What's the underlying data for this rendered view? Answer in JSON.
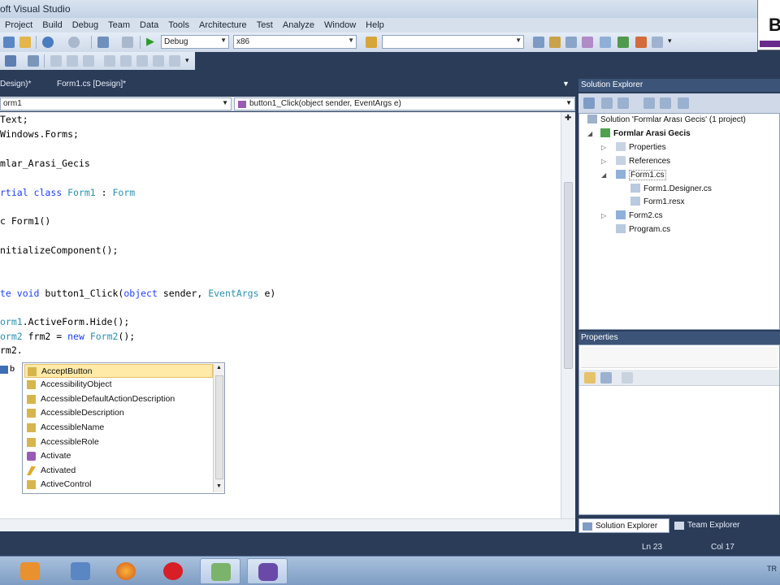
{
  "window": {
    "title": "oft Visual Studio"
  },
  "badge": {
    "letter": "B"
  },
  "menu": [
    "Project",
    "Build",
    "Debug",
    "Team",
    "Data",
    "Tools",
    "Architecture",
    "Test",
    "Analyze",
    "Window",
    "Help"
  ],
  "toolbar": {
    "config": "Debug",
    "platform": "x86",
    "find": ""
  },
  "doc_tabs": [
    {
      "label": "Design)*",
      "active": false
    },
    {
      "label": "Form1.cs [Design]*",
      "active": true
    }
  ],
  "nav": {
    "type": "orm1",
    "member": "button1_Click(object sender, EventArgs e)"
  },
  "code": {
    "l1": "Text;",
    "l2": "Windows.Forms;",
    "l4": "mlar_Arasi_Gecis",
    "l6a": "rtial ",
    "l6b": "class ",
    "l6c": "Form1",
    "l6d": " : ",
    "l6e": "Form",
    "l8a": "c Form1()",
    "l10": "nitializeComponent();",
    "l13a": "te ",
    "l13b": "void",
    "l13c": " button1_Click(",
    "l13d": "object",
    "l13e": " sender, ",
    "l13f": "EventArgs",
    "l13g": " e)",
    "l15a": "orm1",
    "l15b": ".ActiveForm.Hide();",
    "l16a": "orm2",
    "l16b": " frm2 = ",
    "l16c": "new",
    "l16d": " ",
    "l16e": "Form2",
    "l16f": "();",
    "l17": "rm2."
  },
  "intellisense": {
    "gutter_text": "b",
    "items": [
      {
        "label": "AcceptButton",
        "icon": "property-icon",
        "selected": true
      },
      {
        "label": "AccessibilityObject",
        "icon": "property-icon"
      },
      {
        "label": "AccessibleDefaultActionDescription",
        "icon": "property-icon"
      },
      {
        "label": "AccessibleDescription",
        "icon": "property-icon"
      },
      {
        "label": "AccessibleName",
        "icon": "property-icon"
      },
      {
        "label": "AccessibleRole",
        "icon": "property-icon"
      },
      {
        "label": "Activate",
        "icon": "method-icon"
      },
      {
        "label": "Activated",
        "icon": "event-icon"
      },
      {
        "label": "ActiveControl",
        "icon": "property-icon"
      }
    ]
  },
  "solution_explorer": {
    "title": "Solution Explorer",
    "solution": "Solution 'Formlar Arası Gecis' (1 project)",
    "project": "Formlar Arasi Gecis",
    "nodes": [
      "Properties",
      "References",
      "Form1.cs",
      "Form1.Designer.cs",
      "Form1.resx",
      "Form2.cs",
      "Program.cs"
    ]
  },
  "properties": {
    "title": "Properties"
  },
  "bottom_tabs": [
    {
      "label": "Solution Explorer",
      "active": true
    },
    {
      "label": "Team Explorer",
      "active": false
    }
  ],
  "status": {
    "line": "Ln 23",
    "col": "Col 17"
  },
  "tray": {
    "text": "TR"
  },
  "colors": {
    "chrome": "#2b3c59",
    "keyword": "#1f3fff",
    "type": "#2b91af",
    "selection": "#ffeaa8"
  }
}
